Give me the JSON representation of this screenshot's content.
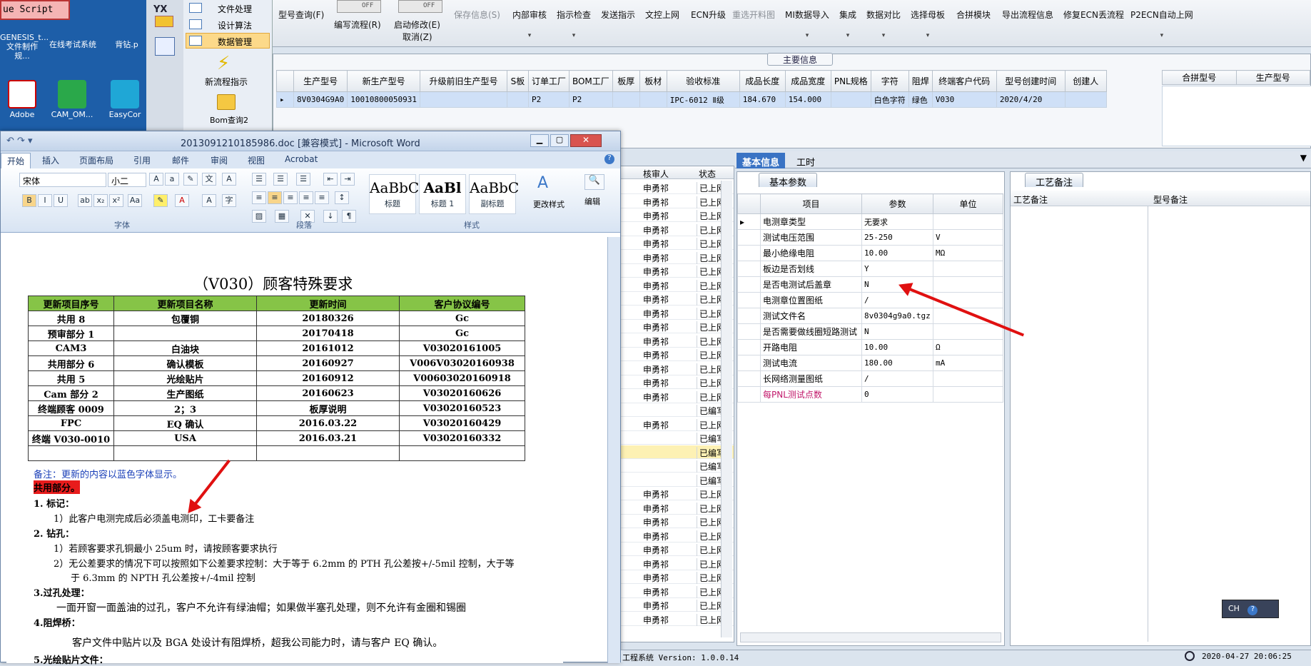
{
  "desktop": {
    "vbscript_label": "ue Script",
    "icons": [
      {
        "label": "GENESIS_t...\n文件制作规..."
      },
      {
        "label": "在线考试系统"
      },
      {
        "label": "背钻.p"
      },
      {
        "label": "Adobe"
      },
      {
        "label": "CAM_OM..."
      },
      {
        "label": "EasyCor"
      }
    ],
    "badge": "YX"
  },
  "leftnav": {
    "items": [
      {
        "label": "文件处理"
      },
      {
        "label": "设计算法"
      },
      {
        "label": "数据管理"
      }
    ],
    "new_flow": "新流程指示",
    "bom_query": "Bom查询2"
  },
  "toolbar": {
    "model_query": "型号查询(F)",
    "write_flow": "编写流程(R)",
    "start_modify": "启动修改(E)",
    "cancel": "取消(Z)",
    "save_info": "保存信息(S)",
    "toggle_off": "OFF",
    "items": [
      "内部审核",
      "指示检查",
      "发送指示",
      "文控上网",
      "ECN升级",
      "重选开料图",
      "MI数据导入",
      "集成",
      "数据对比",
      "选择母板",
      "合拼模块",
      "导出流程信息",
      "修复ECN丢流程",
      "P2ECN自动上网"
    ]
  },
  "main_info": {
    "title": "主要信息",
    "columns": [
      "生产型号",
      "新生产型号",
      "升级前旧生产型号",
      "S板",
      "订单工厂",
      "BOM工厂",
      "板厚",
      "板材",
      "验收标准",
      "成品长度",
      "成品宽度",
      "PNL规格",
      "字符",
      "阻焊",
      "终端客户代码",
      "型号创建时间",
      "创建人"
    ],
    "row": [
      "8V0304G9A0",
      "10010800050931",
      "",
      "",
      "P2",
      "P2",
      "",
      "",
      "IPC-6012 Ⅱ级",
      "184.670",
      "154.000",
      "",
      "白色字符",
      "绿色",
      "V030",
      "2020/4/20",
      ""
    ],
    "right_columns": [
      "合拼型号",
      "生产型号"
    ]
  },
  "mid_list": {
    "headers": [
      "核审人",
      "状态"
    ],
    "rows": [
      {
        "a": "申勇祁",
        "b": "已上网"
      },
      {
        "a": "申勇祁",
        "b": "已上网"
      },
      {
        "a": "申勇祁",
        "b": "已上网"
      },
      {
        "a": "申勇祁",
        "b": "已上网"
      },
      {
        "a": "申勇祁",
        "b": "已上网"
      },
      {
        "a": "申勇祁",
        "b": "已上网"
      },
      {
        "a": "申勇祁",
        "b": "已上网"
      },
      {
        "a": "申勇祁",
        "b": "已上网"
      },
      {
        "a": "申勇祁",
        "b": "已上网"
      },
      {
        "a": "申勇祁",
        "b": "已上网"
      },
      {
        "a": "申勇祁",
        "b": "已上网"
      },
      {
        "a": "申勇祁",
        "b": "已上网"
      },
      {
        "a": "申勇祁",
        "b": "已上网"
      },
      {
        "a": "申勇祁",
        "b": "已上网"
      },
      {
        "a": "申勇祁",
        "b": "已上网"
      },
      {
        "a": "申勇祁",
        "b": "已上网"
      },
      {
        "a": "",
        "b": "已编写"
      },
      {
        "a": "申勇祁",
        "b": "已上网"
      },
      {
        "a": "",
        "b": "已编写"
      },
      {
        "a": "",
        "b": "已编写"
      },
      {
        "a": "",
        "b": "已编写"
      },
      {
        "a": "",
        "b": "已编写"
      },
      {
        "a": "申勇祁",
        "b": "已上网"
      },
      {
        "a": "申勇祁",
        "b": "已上网"
      },
      {
        "a": "申勇祁",
        "b": "已上网"
      },
      {
        "a": "申勇祁",
        "b": "已上网"
      },
      {
        "a": "申勇祁",
        "b": "已上网"
      },
      {
        "a": "申勇祁",
        "b": "已上网"
      },
      {
        "a": "申勇祁",
        "b": "已上网"
      },
      {
        "a": "申勇祁",
        "b": "已上网"
      },
      {
        "a": "申勇祁",
        "b": "已上网"
      },
      {
        "a": "申勇祁",
        "b": "已上网"
      }
    ]
  },
  "detail": {
    "tabs": [
      "基本信息",
      "工时"
    ],
    "basic_tab": "基本参数",
    "craft_tab": "工艺备注",
    "param_headers": [
      "项目",
      "参数",
      "单位"
    ],
    "params": [
      {
        "n": "电测章类型",
        "v": "无要求",
        "u": ""
      },
      {
        "n": "测试电压范围",
        "v": "25-250",
        "u": "V"
      },
      {
        "n": "最小绝缘电阻",
        "v": "10.00",
        "u": "MΩ"
      },
      {
        "n": "板边是否划线",
        "v": "Y",
        "u": ""
      },
      {
        "n": "是否电测试后盖章",
        "v": "N",
        "u": ""
      },
      {
        "n": "电测章位置图纸",
        "v": "/",
        "u": ""
      },
      {
        "n": "测试文件名",
        "v": "8v0304g9a0.tgz",
        "u": ""
      },
      {
        "n": "是否需要做线圈短路测试",
        "v": "N",
        "u": ""
      },
      {
        "n": "开路电阻",
        "v": "10.00",
        "u": "Ω"
      },
      {
        "n": "测试电流",
        "v": "180.00",
        "u": "mA"
      },
      {
        "n": "长网络测量图纸",
        "v": "/",
        "u": ""
      },
      {
        "n": "每PNL测试点数",
        "v": "0",
        "u": ""
      }
    ],
    "craft_headers": [
      "工艺备注",
      "型号备注"
    ]
  },
  "word": {
    "title": "2013091210185986.doc [兼容模式] - Microsoft Word",
    "tabs": [
      "开始",
      "插入",
      "页面布局",
      "引用",
      "邮件",
      "审阅",
      "视图",
      "Acrobat"
    ],
    "font_name": "宋体",
    "font_size": "小二",
    "groups": [
      "字体",
      "段落",
      "样式"
    ],
    "styles": [
      {
        "big": "AaBbC",
        "lbl": "标题"
      },
      {
        "big": "AaBl",
        "lbl": "标题 1"
      },
      {
        "big": "AaBbC",
        "lbl": "副标题"
      }
    ],
    "change_style": "更改样式",
    "edit": "编辑",
    "doc_title": "（V030）顾客特殊要求",
    "table_headers": [
      "更新项目序号",
      "更新项目名称",
      "更新时间",
      "客户协议编号"
    ],
    "table_rows": [
      [
        "共用 8",
        "包覆铜",
        "20180326",
        "Gc"
      ],
      [
        "预审部分 1",
        "",
        "20170418",
        "Gc"
      ],
      [
        "CAM3",
        "白油块",
        "20161012",
        "V03020161005"
      ],
      [
        "共用部分 6",
        "确认模板",
        "20160927",
        "V006V03020160938"
      ],
      [
        "共用 5",
        "光绘贴片",
        "20160912",
        "V00603020160918"
      ],
      [
        "Cam 部分 2",
        "生产图纸",
        "20160623",
        "V03020160626"
      ],
      [
        "终端顾客 0009",
        "2；3",
        "板厚说明",
        "V03020160523"
      ],
      [
        "FPC",
        "EQ 确认",
        "2016.03.22",
        "V03020160429"
      ],
      [
        "终端 V030-0010",
        "USA",
        "2016.03.21",
        "V03020160332"
      ],
      [
        "",
        "",
        "",
        ""
      ]
    ],
    "note": "备注：更新的内容以蓝色字体显示。",
    "common": "共用部分。",
    "lines": [
      "1.   标记：",
      "1）此客户电测完成后必须盖电测印，工卡要备注",
      "2.   钻孔：",
      "1）若顾客要求孔铜最小 25um 时，请按顾客要求执行",
      "2）无公差要求的情况下可以按照如下公差要求控制：大于等于 6.2mm 的 PTH 孔公差按+/-5mil 控制，大于等",
      "于 6.3mm 的 NPTH 孔公差按+/-4mil 控制",
      "3.过孔处理：",
      "一面开窗一面盖油的过孔，客户不允许有绿油帽；如果做半塞孔处理，则不允许有金圈和锡圈",
      "4.阻焊桥：",
      "客户文件中贴片以及 BGA 处设计有阻焊桥，超我公司能力时，请与客户 EQ 确认。",
      "5.光绘贴片文件："
    ]
  },
  "status": {
    "version": "工程系统 Version: 1.0.0.14",
    "datetime": "2020-04-27 20:06:25"
  },
  "ime": "CH"
}
